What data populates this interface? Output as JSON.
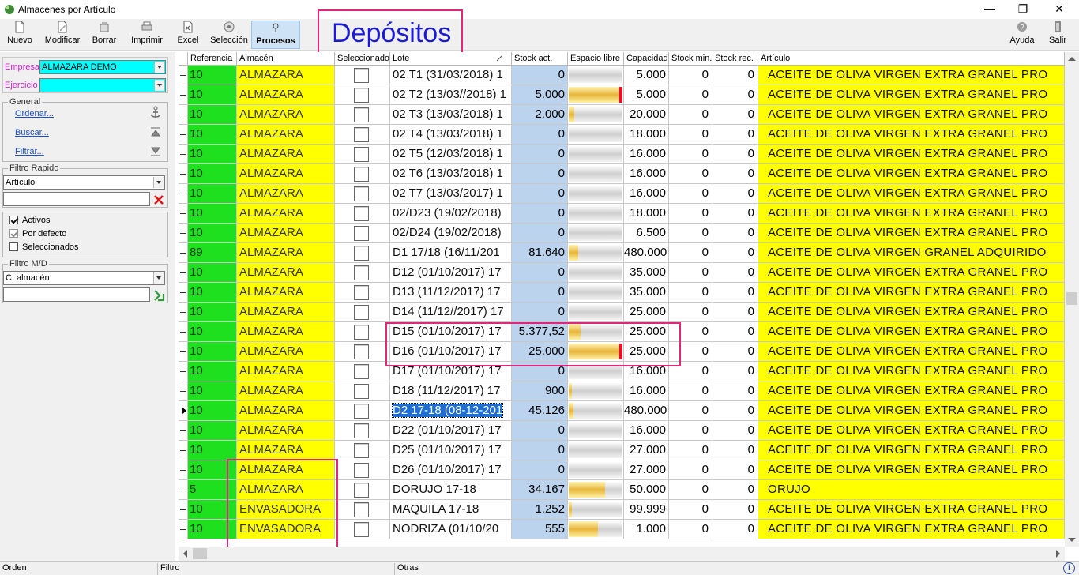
{
  "window": {
    "title": "Almacenes por Artículo",
    "controls": {
      "minimize": "—",
      "restore": "❐",
      "close": "✕"
    }
  },
  "annotation": {
    "text": "Depósitos",
    "color": "#e0277d",
    "text_color": "#1b1bd6"
  },
  "toolbar": {
    "items": [
      {
        "label": "Nuevo",
        "icon": "new-document-icon"
      },
      {
        "label": "Modificar",
        "icon": "edit-icon"
      },
      {
        "label": "Borrar",
        "icon": "delete-icon"
      },
      {
        "label": "Imprimir",
        "icon": "printer-icon"
      },
      {
        "label": "Excel",
        "icon": "excel-icon"
      },
      {
        "label": "Selección",
        "icon": "selection-icon"
      },
      {
        "label": "Procesos",
        "icon": "process-icon"
      }
    ],
    "right": [
      {
        "label": "Ayuda",
        "icon": "help-icon"
      },
      {
        "label": "Salir",
        "icon": "exit-icon"
      }
    ]
  },
  "sidebar": {
    "empresa_label": "Empresa",
    "empresa_value": "ALMAZARA DEMO",
    "ejercicio_label": "Ejercicio",
    "ejercicio_value": "",
    "general_label": "General",
    "ordenar": "Ordenar...",
    "buscar": "Buscar...",
    "filtrar": "Filtrar...",
    "filtro_rapido_label": "Filtro Rapido",
    "filtro_rapido_value": "Artículo",
    "filtro_rapido_text": "",
    "checks": [
      {
        "label": "Activos",
        "checked": true
      },
      {
        "label": "Por defecto",
        "checked": true
      },
      {
        "label": "Seleccionados",
        "checked": false
      }
    ],
    "filtro_md_label": "Filtro M/D",
    "filtro_md_value": "C. almacén",
    "filtro_md_text": ""
  },
  "grid": {
    "columns": [
      "Referencia",
      "Almacén",
      "Seleccionado",
      "Lote",
      "Stock act.",
      "Espacio libre",
      "Capacidad",
      "Stock min.",
      "Stock rec.",
      "Artículo"
    ],
    "rows": [
      {
        "ref": "10",
        "alm": "ALMAZARA",
        "lote": "02 T1 (31/03/2018) 1",
        "stock": "0",
        "fill": 0,
        "full": false,
        "cap": "5.000",
        "min": "0",
        "rec": "0",
        "art": "ACEITE DE OLIVA VIRGEN EXTRA GRANEL PRO"
      },
      {
        "ref": "10",
        "alm": "ALMAZARA",
        "lote": "02 T2 (13/03//2018) 1",
        "stock": "5.000",
        "fill": 1,
        "full": true,
        "cap": "5.000",
        "min": "0",
        "rec": "0",
        "art": "ACEITE DE OLIVA VIRGEN EXTRA GRANEL PRO"
      },
      {
        "ref": "10",
        "alm": "ALMAZARA",
        "lote": "02 T3 (13/03/2018) 1",
        "stock": "2.000",
        "fill": 0.1,
        "full": false,
        "cap": "20.000",
        "min": "0",
        "rec": "0",
        "art": "ACEITE DE OLIVA VIRGEN EXTRA GRANEL PRO"
      },
      {
        "ref": "10",
        "alm": "ALMAZARA",
        "lote": "02 T4 (13/03/2018) 1",
        "stock": "0",
        "fill": 0,
        "full": false,
        "cap": "18.000",
        "min": "0",
        "rec": "0",
        "art": "ACEITE DE OLIVA VIRGEN EXTRA GRANEL PRO"
      },
      {
        "ref": "10",
        "alm": "ALMAZARA",
        "lote": "02 T5 (12/03/2018) 1",
        "stock": "0",
        "fill": 0,
        "full": false,
        "cap": "16.000",
        "min": "0",
        "rec": "0",
        "art": "ACEITE DE OLIVA VIRGEN EXTRA GRANEL PRO"
      },
      {
        "ref": "10",
        "alm": "ALMAZARA",
        "lote": "02 T6 (13/03/2018) 1",
        "stock": "0",
        "fill": 0,
        "full": false,
        "cap": "16.000",
        "min": "0",
        "rec": "0",
        "art": "ACEITE DE OLIVA VIRGEN EXTRA GRANEL PRO"
      },
      {
        "ref": "10",
        "alm": "ALMAZARA",
        "lote": "02 T7 (13/03/2017) 1",
        "stock": "0",
        "fill": 0,
        "full": false,
        "cap": "16.000",
        "min": "0",
        "rec": "0",
        "art": "ACEITE DE OLIVA VIRGEN EXTRA GRANEL PRO"
      },
      {
        "ref": "10",
        "alm": "ALMAZARA",
        "lote": "02/D23 (19/02/2018)",
        "stock": "0",
        "fill": 0,
        "full": false,
        "cap": "18.000",
        "min": "0",
        "rec": "0",
        "art": "ACEITE DE OLIVA VIRGEN EXTRA GRANEL PRO"
      },
      {
        "ref": "10",
        "alm": "ALMAZARA",
        "lote": "02/D24 (19/02/2018)",
        "stock": "0",
        "fill": 0,
        "full": false,
        "cap": "6.500",
        "min": "0",
        "rec": "0",
        "art": "ACEITE DE OLIVA VIRGEN EXTRA GRANEL PRO"
      },
      {
        "ref": "89",
        "alm": "ALMAZARA",
        "lote": "D1 17/18 (16/11/201",
        "stock": "81.640",
        "fill": 0.17,
        "full": false,
        "cap": "480.000",
        "min": "0",
        "rec": "0",
        "art": "ACEITE DE OLIVA VIRGEN GRANEL ADQUIRIDO"
      },
      {
        "ref": "10",
        "alm": "ALMAZARA",
        "lote": "D12 (01/10/2017) 17",
        "stock": "0",
        "fill": 0,
        "full": false,
        "cap": "35.000",
        "min": "0",
        "rec": "0",
        "art": "ACEITE DE OLIVA VIRGEN EXTRA GRANEL PRO"
      },
      {
        "ref": "10",
        "alm": "ALMAZARA",
        "lote": "D13 (11/12/2017) 17",
        "stock": "0",
        "fill": 0,
        "full": false,
        "cap": "35.000",
        "min": "0",
        "rec": "0",
        "art": "ACEITE DE OLIVA VIRGEN EXTRA GRANEL PRO"
      },
      {
        "ref": "10",
        "alm": "ALMAZARA",
        "lote": "D14 (11/12//2017) 17",
        "stock": "0",
        "fill": 0,
        "full": false,
        "cap": "25.000",
        "min": "0",
        "rec": "0",
        "art": "ACEITE DE OLIVA VIRGEN EXTRA GRANEL PRO"
      },
      {
        "ref": "10",
        "alm": "ALMAZARA",
        "lote": "D15 (01/10/2017) 17",
        "stock": "5.377,52",
        "fill": 0.22,
        "full": false,
        "cap": "25.000",
        "min": "0",
        "rec": "0",
        "art": "ACEITE DE OLIVA VIRGEN EXTRA GRANEL PRO"
      },
      {
        "ref": "10",
        "alm": "ALMAZARA",
        "lote": "D16 (01/10/2017) 17",
        "stock": "25.000",
        "fill": 1,
        "full": true,
        "cap": "25.000",
        "min": "0",
        "rec": "0",
        "art": "ACEITE DE OLIVA VIRGEN EXTRA GRANEL PRO"
      },
      {
        "ref": "10",
        "alm": "ALMAZARA",
        "lote": "D17 (01/10/2017) 17",
        "stock": "0",
        "fill": 0,
        "full": false,
        "cap": "16.000",
        "min": "0",
        "rec": "0",
        "art": "ACEITE DE OLIVA VIRGEN EXTRA GRANEL PRO"
      },
      {
        "ref": "10",
        "alm": "ALMAZARA",
        "lote": "D18 (11/12/2017) 17",
        "stock": "900",
        "fill": 0.06,
        "full": false,
        "cap": "16.000",
        "min": "0",
        "rec": "0",
        "art": "ACEITE DE OLIVA VIRGEN EXTRA GRANEL PRO"
      },
      {
        "ref": "10",
        "alm": "ALMAZARA",
        "lote": "D2 17-18 (08-12-201",
        "stock": "45.126",
        "fill": 0.09,
        "full": false,
        "cap": "480.000",
        "min": "0",
        "rec": "0",
        "art": "ACEITE DE OLIVA VIRGEN EXTRA GRANEL PRO",
        "current": true
      },
      {
        "ref": "10",
        "alm": "ALMAZARA",
        "lote": "D22 (01/10/2017) 17",
        "stock": "0",
        "fill": 0,
        "full": false,
        "cap": "16.000",
        "min": "0",
        "rec": "0",
        "art": "ACEITE DE OLIVA VIRGEN EXTRA GRANEL PRO"
      },
      {
        "ref": "10",
        "alm": "ALMAZARA",
        "lote": "D25 (01/10/2017) 17",
        "stock": "0",
        "fill": 0,
        "full": false,
        "cap": "27.000",
        "min": "0",
        "rec": "0",
        "art": "ACEITE DE OLIVA VIRGEN EXTRA GRANEL PRO"
      },
      {
        "ref": "10",
        "alm": "ALMAZARA",
        "lote": "D26 (01/10/2017) 17",
        "stock": "0",
        "fill": 0,
        "full": false,
        "cap": "27.000",
        "min": "0",
        "rec": "0",
        "art": "ACEITE DE OLIVA VIRGEN EXTRA GRANEL PRO"
      },
      {
        "ref": "5",
        "alm": "ALMAZARA",
        "lote": "DORUJO 17-18",
        "stock": "34.167",
        "fill": 0.68,
        "full": false,
        "cap": "50.000",
        "min": "0",
        "rec": "0",
        "art": "ORUJO"
      },
      {
        "ref": "10",
        "alm": "ENVASADORA",
        "lote": "MAQUILA 17-18",
        "stock": "1.252",
        "fill": 0.01,
        "full": false,
        "cap": "99.999",
        "min": "0",
        "rec": "0",
        "art": "ACEITE DE OLIVA VIRGEN EXTRA GRANEL PRO"
      },
      {
        "ref": "10",
        "alm": "ENVASADORA",
        "lote": "NODRIZA (01/10/20",
        "stock": "555",
        "fill": 0.55,
        "full": false,
        "cap": "1.000",
        "min": "0",
        "rec": "0",
        "art": "ACEITE DE OLIVA VIRGEN EXTRA GRANEL PRO"
      }
    ]
  },
  "statusbar": {
    "orden": "Orden",
    "filtro": "Filtro",
    "otras": "Otras"
  }
}
